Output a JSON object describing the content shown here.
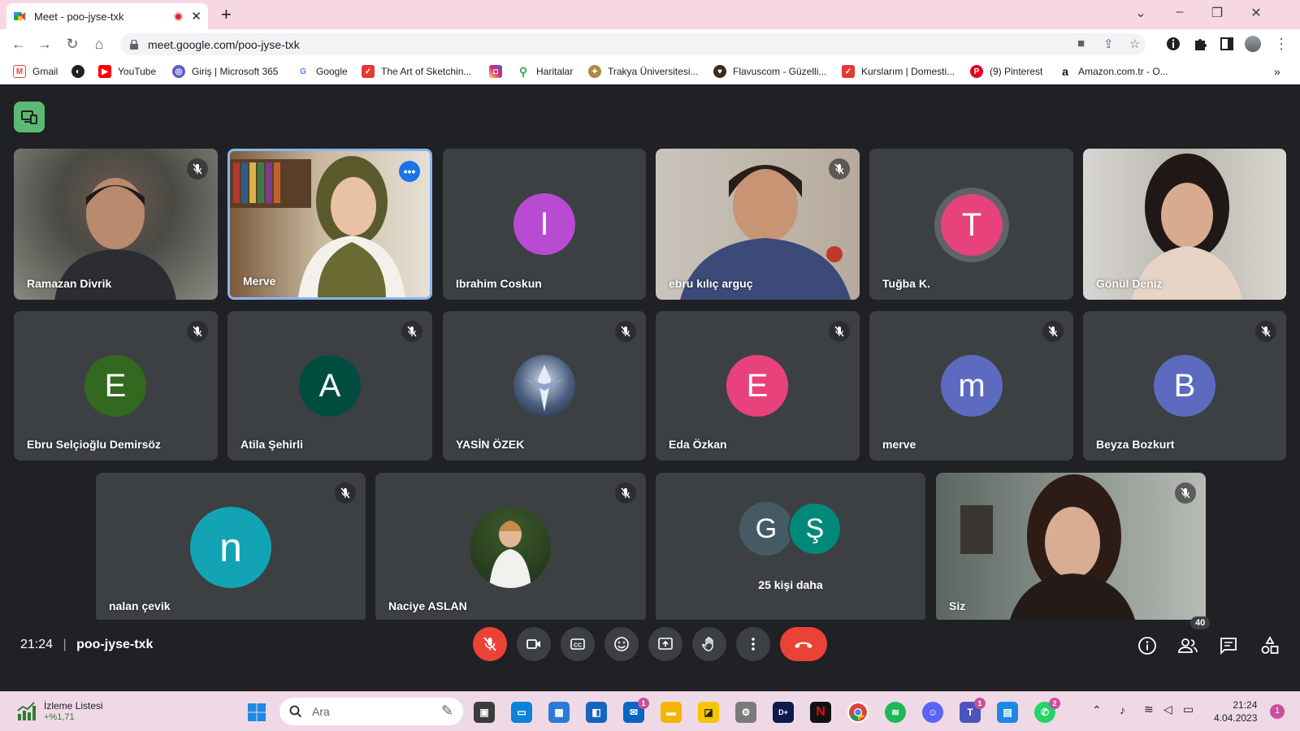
{
  "browser": {
    "tab_title": "Meet - poo-jyse-txk",
    "url": "meet.google.com/poo-jyse-txk",
    "bookmarks": [
      {
        "label": "Gmail",
        "icon": "gmail-icon",
        "color": "#ea4335"
      },
      {
        "label": "",
        "icon": "globe-icon",
        "color": "#202124"
      },
      {
        "label": "YouTube",
        "icon": "youtube-icon",
        "color": "#ff0000"
      },
      {
        "label": "Giriş | Microsoft 365",
        "icon": "microsoft365-icon",
        "color": "#5b5fc7"
      },
      {
        "label": "Google",
        "icon": "google-icon",
        "color": "#4285f4"
      },
      {
        "label": "The Art of Sketchin...",
        "icon": "bookmark-site-icon",
        "color": "#e53935"
      },
      {
        "label": "",
        "icon": "instagram-icon",
        "color": "#d6249f"
      },
      {
        "label": "Haritalar",
        "icon": "maps-icon",
        "color": "#34a853"
      },
      {
        "label": "Trakya Üniversitesi...",
        "icon": "university-icon",
        "color": "#b08a3e"
      },
      {
        "label": "Flavuscom - Güzelli...",
        "icon": "flavus-icon",
        "color": "#3c2a1e"
      },
      {
        "label": "Kurslarım | Domesti...",
        "icon": "domestika-icon",
        "color": "#e53935"
      },
      {
        "label": "(9) Pinterest",
        "icon": "pinterest-icon",
        "color": "#e60023"
      },
      {
        "label": "Amazon.com.tr - O...",
        "icon": "amazon-icon",
        "color": "#111111"
      }
    ]
  },
  "meet": {
    "tiles": [
      {
        "name": "Ramazan Divrik",
        "type": "video",
        "muted": true
      },
      {
        "name": "Merve",
        "type": "video",
        "muted": false,
        "selected": true
      },
      {
        "name": "Ibrahim Coskun",
        "type": "letter",
        "letter": "I",
        "color": "#b84bd1",
        "muted": false
      },
      {
        "name": "ebru kılıç arguç",
        "type": "video",
        "muted": true
      },
      {
        "name": "Tuğba K.",
        "type": "letter",
        "letter": "T",
        "color": "#e8427c",
        "muted": false
      },
      {
        "name": "Gönül Deniz",
        "type": "video",
        "muted": false
      },
      {
        "name": "Ebru Selçioğlu Demirsöz",
        "type": "letter",
        "letter": "E",
        "color": "#33691e",
        "muted": true
      },
      {
        "name": "Atila Şehirli",
        "type": "letter",
        "letter": "A",
        "color": "#004d40",
        "muted": true
      },
      {
        "name": "YASİN ÖZEK",
        "type": "photo",
        "muted": true
      },
      {
        "name": "Eda Özkan",
        "type": "letter",
        "letter": "E",
        "color": "#e8427c",
        "muted": true
      },
      {
        "name": "merve",
        "type": "letter",
        "letter": "m",
        "color": "#5c6bc0",
        "muted": true
      },
      {
        "name": "Beyza Bozkurt",
        "type": "letter",
        "letter": "B",
        "color": "#5c6bc0",
        "muted": true
      },
      {
        "name": "nalan çevik",
        "type": "letter",
        "letter": "n",
        "color": "#12a4b5",
        "muted": true
      },
      {
        "name": "Naciye ASLAN",
        "type": "photo",
        "muted": true
      },
      {
        "name": "25 kişi daha",
        "type": "others",
        "letters": [
          "G",
          "Ş"
        ],
        "colors": [
          "#455a64",
          "#00897b"
        ]
      },
      {
        "name": "Siz",
        "type": "video",
        "muted": true
      }
    ],
    "time": "21:24",
    "meeting_code": "poo-jyse-txk",
    "participant_count": "40"
  },
  "taskbar": {
    "widget_title": "İzleme Listesi",
    "widget_value": "+%1,71",
    "search_placeholder": "Ara",
    "clock_time": "21:24",
    "clock_date": "4.04.2023",
    "notification_count": "1",
    "mail_badge": "1",
    "teams_badge": "1",
    "whatsapp_badge": "2"
  },
  "colors": {
    "meet_bg": "#202124",
    "tile_bg": "#3c4043",
    "end_call": "#ea4335",
    "accent": "#1a73e8"
  }
}
